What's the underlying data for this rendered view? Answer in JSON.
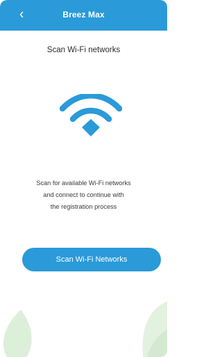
{
  "app": {
    "title": "Breez Max"
  },
  "header": {
    "back_icon": "chevron-left-icon"
  },
  "main": {
    "heading": "Scan Wi-Fi networks",
    "icon": "wifi-icon",
    "description_lines": [
      "Scan for available Wi-Fi networks",
      "and connect to continue with",
      "the registration process"
    ],
    "scan_button_label": "Scan Wi-Fi Networks"
  },
  "colors": {
    "accent": "#2a9ad9",
    "leaf_left": "#dcefd9",
    "leaf_right": "#e3f2e0"
  }
}
